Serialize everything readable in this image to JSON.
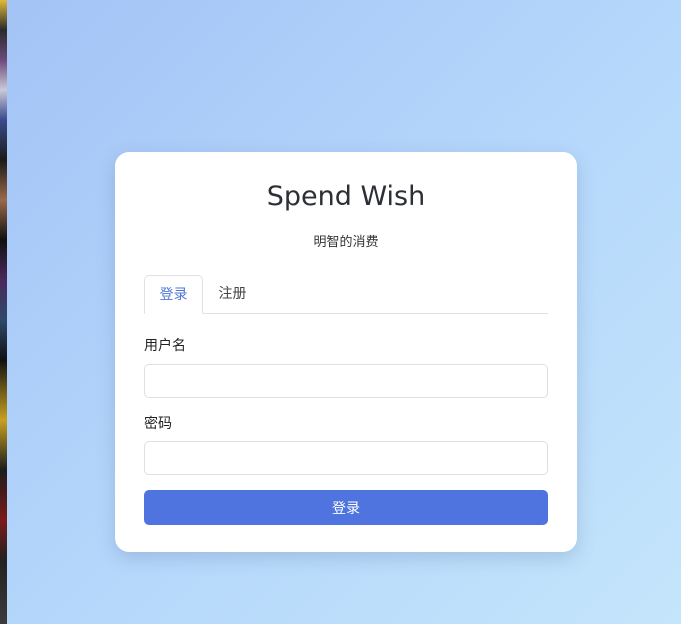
{
  "login": {
    "title": "Spend Wish",
    "subtitle": "明智的消费",
    "tabs": [
      {
        "label": "登录",
        "active": true
      },
      {
        "label": "注册",
        "active": false
      }
    ],
    "username": {
      "label": "用户名",
      "value": "",
      "placeholder": ""
    },
    "password": {
      "label": "密码",
      "value": "",
      "placeholder": ""
    },
    "submit_label": "登录"
  },
  "colors": {
    "accent": "#4f74df",
    "active_tab_text": "#4f74d9",
    "background_start": "#a3c3f6",
    "background_end": "#c4e5fb",
    "card": "#ffffff"
  }
}
